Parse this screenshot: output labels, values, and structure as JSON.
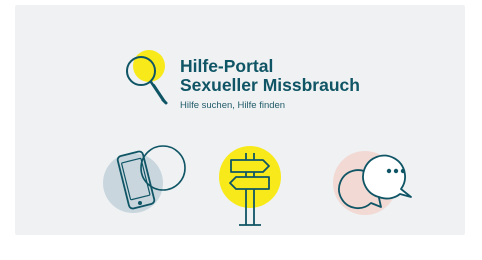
{
  "header": {
    "title_line1": "Hilfe-Portal",
    "title_line2": "Sexueller Missbrauch",
    "tagline": "Hilfe suchen, Hilfe finden"
  },
  "icons": {
    "logo": "magnifier-icon",
    "phone": "smartphone-icon",
    "signpost": "signpost-icon",
    "chat": "chat-bubbles-icon"
  },
  "colors": {
    "card_bg": "#eff1f3",
    "primary": "#0f5565",
    "yellow": "#f8ea1a",
    "blue_circle": "#c9d6de",
    "pink_circle": "#f2d9d4"
  }
}
